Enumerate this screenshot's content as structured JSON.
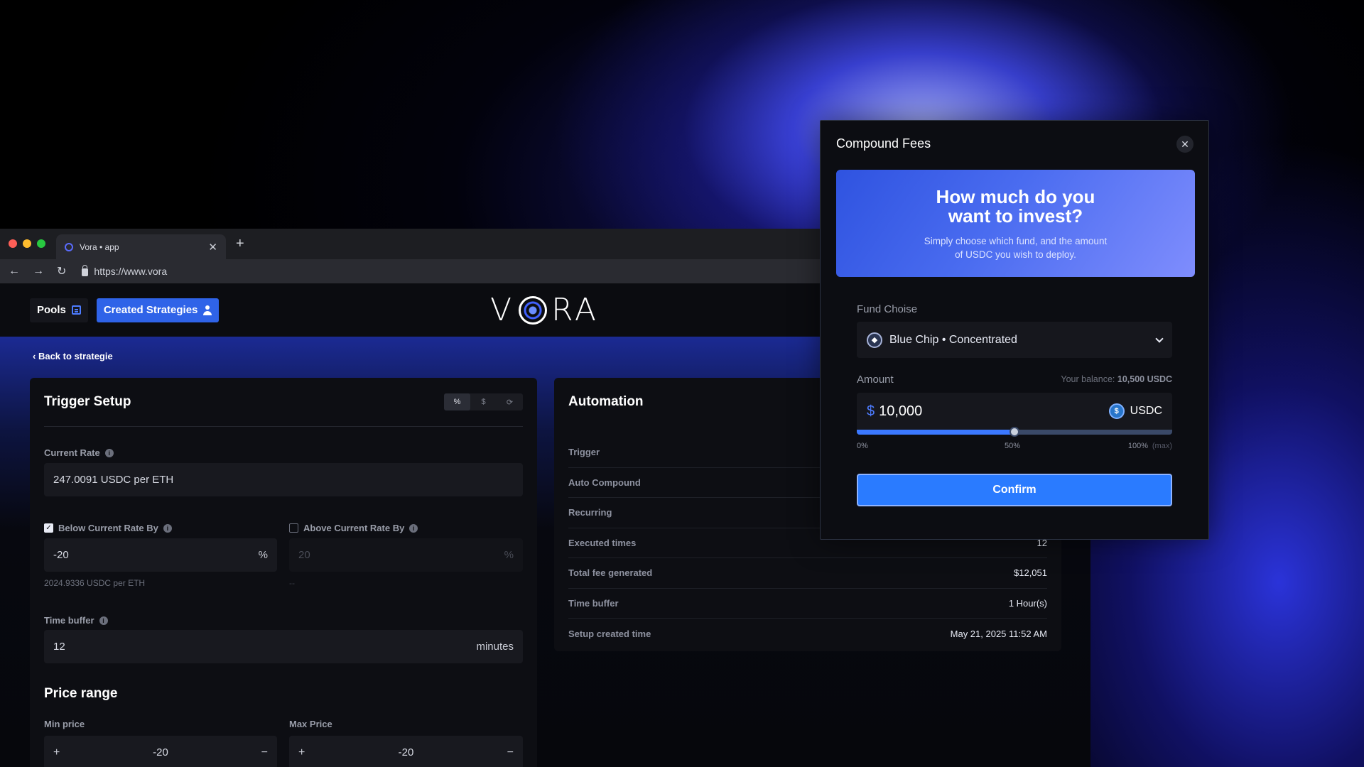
{
  "browser": {
    "tab_title": "Vora • app",
    "url": "https://www.vora",
    "new_tab": "+",
    "close_tab": "✕"
  },
  "header": {
    "nav": [
      {
        "label": "Pools",
        "icon": "list-icon"
      },
      {
        "label": "Created Strategies",
        "icon": "user-icon"
      }
    ],
    "logo_left": "V",
    "logo_right": "RA"
  },
  "back_link": "Back to strategie",
  "trigger_setup": {
    "title": "Trigger Setup",
    "unit_toggle": [
      "%",
      "$",
      "⟳"
    ],
    "current_rate_label": "Current Rate",
    "current_rate_value": "247.0091 USDC per ETH",
    "below": {
      "label": "Below Current Rate By",
      "checked": true,
      "value": "-20",
      "suffix": "%",
      "hint": "2024.9336 USDC per ETH"
    },
    "above": {
      "label": "Above Current Rate By",
      "checked": false,
      "value": "20",
      "suffix": "%",
      "hint": "--"
    },
    "time_buffer_label": "Time buffer",
    "time_buffer_value": "12",
    "time_buffer_unit": "minutes",
    "price_range_title": "Price range",
    "min_price_label": "Min price",
    "min_price_value": "-20",
    "max_price_label": "Max Price",
    "max_price_value": "-20",
    "plus": "+",
    "minus": "−"
  },
  "automation": {
    "title": "Automation",
    "rows": [
      {
        "key": "Trigger",
        "value": ""
      },
      {
        "key": "Auto Compound",
        "value": ""
      },
      {
        "key": "Recurring",
        "value": ""
      },
      {
        "key": "Executed times",
        "value": "12"
      },
      {
        "key": "Total fee generated",
        "value": "$12,051"
      },
      {
        "key": "Time buffer",
        "value": "1 Hour(s)"
      },
      {
        "key": "Setup created time",
        "value": "May 21, 2025 11:52 AM"
      }
    ]
  },
  "modal": {
    "title": "Compound Fees",
    "close": "✕",
    "hero_title": "How much do you want to invest?",
    "hero_sub": "Simply choose which fund, and the amount of USDC you wish to deploy.",
    "fund_label": "Fund Choise",
    "fund_value": "Blue Chip • Concentrated",
    "amount_label": "Amount",
    "balance_prefix": "Your balance:",
    "balance_value": "10,500 USDC",
    "amount_symbol": "$",
    "amount_value": "10,000",
    "currency": "USDC",
    "slider_fraction": 0.5,
    "tick_0": "0%",
    "tick_50": "50%",
    "tick_100": "100%",
    "tick_max": "(max)",
    "confirm": "Confirm"
  },
  "colors": {
    "accent": "#2f63e8",
    "confirm": "#2a7bff",
    "usdc": "#2775ca"
  }
}
